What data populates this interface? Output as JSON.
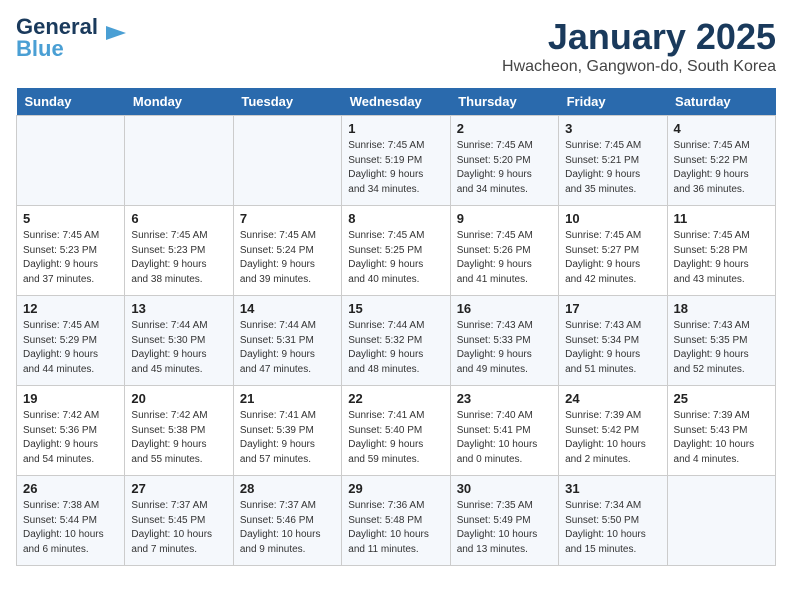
{
  "logo": {
    "line1": "General",
    "line2": "Blue"
  },
  "title": "January 2025",
  "location": "Hwacheon, Gangwon-do, South Korea",
  "headers": [
    "Sunday",
    "Monday",
    "Tuesday",
    "Wednesday",
    "Thursday",
    "Friday",
    "Saturday"
  ],
  "weeks": [
    [
      {
        "day": "",
        "text": ""
      },
      {
        "day": "",
        "text": ""
      },
      {
        "day": "",
        "text": ""
      },
      {
        "day": "1",
        "text": "Sunrise: 7:45 AM\nSunset: 5:19 PM\nDaylight: 9 hours\nand 34 minutes."
      },
      {
        "day": "2",
        "text": "Sunrise: 7:45 AM\nSunset: 5:20 PM\nDaylight: 9 hours\nand 34 minutes."
      },
      {
        "day": "3",
        "text": "Sunrise: 7:45 AM\nSunset: 5:21 PM\nDaylight: 9 hours\nand 35 minutes."
      },
      {
        "day": "4",
        "text": "Sunrise: 7:45 AM\nSunset: 5:22 PM\nDaylight: 9 hours\nand 36 minutes."
      }
    ],
    [
      {
        "day": "5",
        "text": "Sunrise: 7:45 AM\nSunset: 5:23 PM\nDaylight: 9 hours\nand 37 minutes."
      },
      {
        "day": "6",
        "text": "Sunrise: 7:45 AM\nSunset: 5:23 PM\nDaylight: 9 hours\nand 38 minutes."
      },
      {
        "day": "7",
        "text": "Sunrise: 7:45 AM\nSunset: 5:24 PM\nDaylight: 9 hours\nand 39 minutes."
      },
      {
        "day": "8",
        "text": "Sunrise: 7:45 AM\nSunset: 5:25 PM\nDaylight: 9 hours\nand 40 minutes."
      },
      {
        "day": "9",
        "text": "Sunrise: 7:45 AM\nSunset: 5:26 PM\nDaylight: 9 hours\nand 41 minutes."
      },
      {
        "day": "10",
        "text": "Sunrise: 7:45 AM\nSunset: 5:27 PM\nDaylight: 9 hours\nand 42 minutes."
      },
      {
        "day": "11",
        "text": "Sunrise: 7:45 AM\nSunset: 5:28 PM\nDaylight: 9 hours\nand 43 minutes."
      }
    ],
    [
      {
        "day": "12",
        "text": "Sunrise: 7:45 AM\nSunset: 5:29 PM\nDaylight: 9 hours\nand 44 minutes."
      },
      {
        "day": "13",
        "text": "Sunrise: 7:44 AM\nSunset: 5:30 PM\nDaylight: 9 hours\nand 45 minutes."
      },
      {
        "day": "14",
        "text": "Sunrise: 7:44 AM\nSunset: 5:31 PM\nDaylight: 9 hours\nand 47 minutes."
      },
      {
        "day": "15",
        "text": "Sunrise: 7:44 AM\nSunset: 5:32 PM\nDaylight: 9 hours\nand 48 minutes."
      },
      {
        "day": "16",
        "text": "Sunrise: 7:43 AM\nSunset: 5:33 PM\nDaylight: 9 hours\nand 49 minutes."
      },
      {
        "day": "17",
        "text": "Sunrise: 7:43 AM\nSunset: 5:34 PM\nDaylight: 9 hours\nand 51 minutes."
      },
      {
        "day": "18",
        "text": "Sunrise: 7:43 AM\nSunset: 5:35 PM\nDaylight: 9 hours\nand 52 minutes."
      }
    ],
    [
      {
        "day": "19",
        "text": "Sunrise: 7:42 AM\nSunset: 5:36 PM\nDaylight: 9 hours\nand 54 minutes."
      },
      {
        "day": "20",
        "text": "Sunrise: 7:42 AM\nSunset: 5:38 PM\nDaylight: 9 hours\nand 55 minutes."
      },
      {
        "day": "21",
        "text": "Sunrise: 7:41 AM\nSunset: 5:39 PM\nDaylight: 9 hours\nand 57 minutes."
      },
      {
        "day": "22",
        "text": "Sunrise: 7:41 AM\nSunset: 5:40 PM\nDaylight: 9 hours\nand 59 minutes."
      },
      {
        "day": "23",
        "text": "Sunrise: 7:40 AM\nSunset: 5:41 PM\nDaylight: 10 hours\nand 0 minutes."
      },
      {
        "day": "24",
        "text": "Sunrise: 7:39 AM\nSunset: 5:42 PM\nDaylight: 10 hours\nand 2 minutes."
      },
      {
        "day": "25",
        "text": "Sunrise: 7:39 AM\nSunset: 5:43 PM\nDaylight: 10 hours\nand 4 minutes."
      }
    ],
    [
      {
        "day": "26",
        "text": "Sunrise: 7:38 AM\nSunset: 5:44 PM\nDaylight: 10 hours\nand 6 minutes."
      },
      {
        "day": "27",
        "text": "Sunrise: 7:37 AM\nSunset: 5:45 PM\nDaylight: 10 hours\nand 7 minutes."
      },
      {
        "day": "28",
        "text": "Sunrise: 7:37 AM\nSunset: 5:46 PM\nDaylight: 10 hours\nand 9 minutes."
      },
      {
        "day": "29",
        "text": "Sunrise: 7:36 AM\nSunset: 5:48 PM\nDaylight: 10 hours\nand 11 minutes."
      },
      {
        "day": "30",
        "text": "Sunrise: 7:35 AM\nSunset: 5:49 PM\nDaylight: 10 hours\nand 13 minutes."
      },
      {
        "day": "31",
        "text": "Sunrise: 7:34 AM\nSunset: 5:50 PM\nDaylight: 10 hours\nand 15 minutes."
      },
      {
        "day": "",
        "text": ""
      }
    ]
  ]
}
